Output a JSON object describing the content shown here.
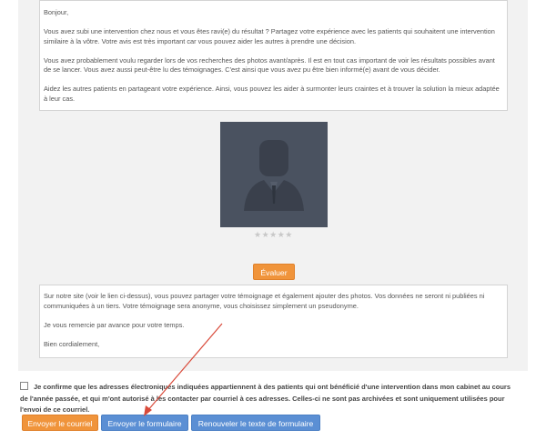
{
  "message_top": {
    "paragraphs": [
      "Bonjour,",
      "Vous avez subi une intervention chez nous et vous êtes ravi(e) du résultat ? Partagez votre expérience avec les patients qui souhaitent une intervention similaire à la vôtre. Votre avis est très important car vous pouvez aider les autres à prendre une décision.",
      "Vous avez probablement voulu regarder lors de vos recherches des photos avant/après. Il est en tout cas important de voir les résultats possibles avant de se lancer. Vous avez aussi peut-être lu des témoignages. C'est ainsi que vous avez pu être bien informé(e) avant de vous décider.",
      "Aidez les autres patients en partageant votre expérience. Ainsi, vous pouvez les aider à surmonter leurs craintes et à trouver la solution la mieux adaptée à leur cas."
    ]
  },
  "rating": {
    "stars": "★★★★★",
    "value": 0,
    "max": 5
  },
  "evaluate_label": "Évaluer",
  "message_bottom": {
    "paragraphs": [
      "Sur notre site (voir le lien ci-dessus), vous pouvez partager votre témoignage et également ajouter des photos. Vos données ne seront ni publiées ni communiquées à un tiers. Votre témoignage sera anonyme, vous choisissez simplement un pseudonyme.",
      "Je vous remercie par avance pour votre temps.",
      "Bien cordialement,"
    ]
  },
  "confirm_text": "Je confirme que les adresses électroniques indiquées appartiennent à des patients qui ont bénéficié d'une intervention dans mon cabinet au cours de l'année passée, et qui m'ont autorisé à les contacter par courriel à ces adresses. Celles-ci ne sont pas archivées et sont uniquement utilisées pour l'envoi de ce courriel.",
  "buttons": {
    "send_mail": "Envoyer le courriel",
    "send_form": "Envoyer le formulaire",
    "renew": "Renouveler le texte de formulaire"
  },
  "colors": {
    "orange": "#f0943b",
    "blue": "#5b8fd4",
    "arrow": "#d94a3a",
    "avatar_bg": "#4a5260"
  },
  "icons": {
    "avatar": "person-silhouette-icon",
    "arrow": "arrow-annotation-icon"
  }
}
